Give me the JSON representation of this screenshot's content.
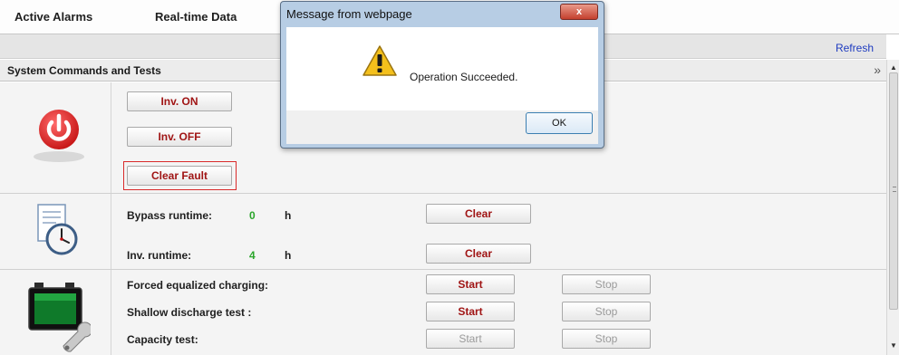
{
  "nav": {
    "tabs": [
      "Active Alarms",
      "Real-time Data"
    ]
  },
  "toolbar": {
    "refresh_label": "Refresh"
  },
  "panel": {
    "title": "System Commands and Tests"
  },
  "inverter": {
    "on_label": "Inv. ON",
    "off_label": "Inv. OFF",
    "clear_fault_label": "Clear Fault"
  },
  "runtime": {
    "bypass_label": "Bypass runtime:",
    "bypass_value": "0",
    "bypass_unit": "h",
    "inv_label": "Inv. runtime:",
    "inv_value": "4",
    "inv_unit": "h",
    "clear_label": "Clear"
  },
  "battery": {
    "rows": [
      {
        "label": "Forced equalized charging:",
        "start": "Start",
        "stop": "Stop"
      },
      {
        "label": "Shallow discharge test :",
        "start": "Start",
        "stop": "Stop"
      },
      {
        "label": "Capacity test:",
        "start": "Start",
        "stop": "Stop"
      }
    ]
  },
  "dialog": {
    "title": "Message from webpage",
    "close_label": "x",
    "message": "Operation Succeeded.",
    "ok_label": "OK"
  },
  "colors": {
    "accent_red": "#a01515",
    "value_green": "#2aa52a",
    "link_blue": "#1f3cc0"
  },
  "icons": [
    "power-icon",
    "clock-document-icon",
    "battery-wrench-icon",
    "warning-icon",
    "collapse-chevron-icon"
  ]
}
